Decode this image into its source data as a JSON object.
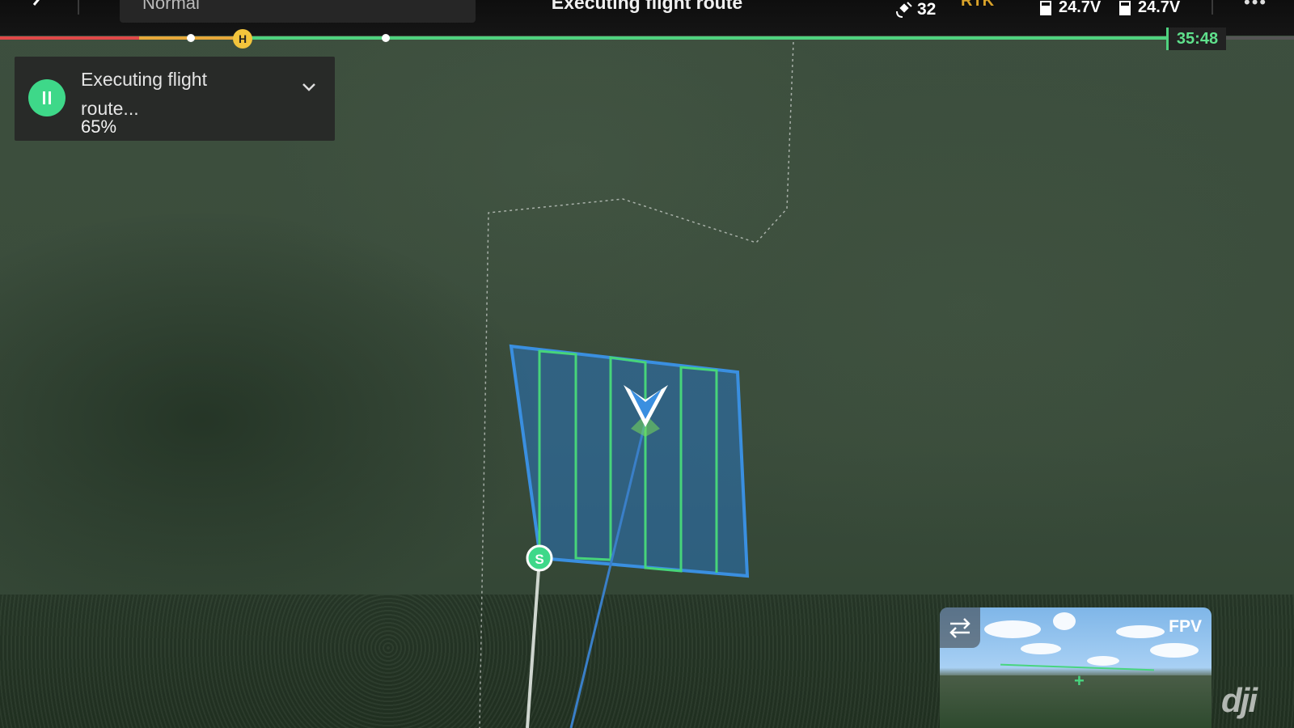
{
  "header": {
    "mode": "Normal",
    "title": "Executing flight route",
    "satellites": "32",
    "rtk": "RTK",
    "battery_left": "24.7V",
    "battery_right": "24.7V"
  },
  "flight_progress": {
    "time_remaining": "35:48",
    "home_label": "H"
  },
  "status_card": {
    "label": "Executing flight route...",
    "percent": "65%"
  },
  "map": {
    "start_marker": "S"
  },
  "fpv": {
    "label": "FPV"
  },
  "brand": {
    "logo": "dji"
  },
  "colors": {
    "accent_green": "#3ed889",
    "route_blue": "#3a8fe0",
    "home_yellow": "#f2c43c"
  }
}
